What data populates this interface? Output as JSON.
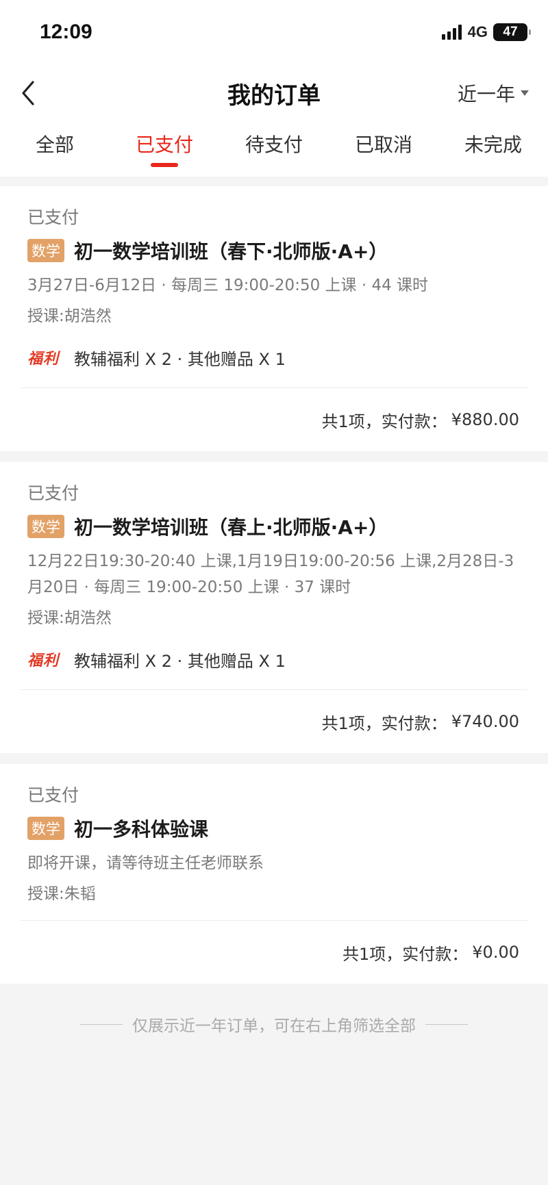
{
  "status_bar": {
    "time": "12:09",
    "network": "4G",
    "battery": "47"
  },
  "header": {
    "title": "我的订单",
    "range_filter": "近一年"
  },
  "tabs": [
    {
      "label": "全部",
      "active": false
    },
    {
      "label": "已支付",
      "active": true
    },
    {
      "label": "待支付",
      "active": false
    },
    {
      "label": "已取消",
      "active": false
    },
    {
      "label": "未完成",
      "active": false
    }
  ],
  "orders": [
    {
      "status": "已支付",
      "subject": "数学",
      "course": "初一数学培训班（春下·北师版·A+）",
      "schedule": "3月27日-6月12日 · 每周三 19:00-20:50 上课 · 44 课时",
      "teacher": "授课:胡浩然",
      "gift_logo": "福利",
      "gifts": "教辅福利 X 2 · 其他赠品 X 1",
      "summary_count": "共1项，实付款：",
      "amount": "¥880.00"
    },
    {
      "status": "已支付",
      "subject": "数学",
      "course": "初一数学培训班（春上·北师版·A+）",
      "schedule": "12月22日19:30-20:40 上课,1月19日19:00-20:56 上课,2月28日-3月20日 · 每周三 19:00-20:50 上课 · 37 课时",
      "teacher": "授课:胡浩然",
      "gift_logo": "福利",
      "gifts": "教辅福利 X 2 · 其他赠品 X 1",
      "summary_count": "共1项，实付款：",
      "amount": "¥740.00"
    },
    {
      "status": "已支付",
      "subject": "数学",
      "course": "初一多科体验课",
      "schedule": "即将开课，请等待班主任老师联系",
      "teacher": "授课:朱韬",
      "summary_count": "共1项，实付款：",
      "amount": "¥0.00"
    }
  ],
  "footer_note": "仅展示近一年订单，可在右上角筛选全部",
  "colors": {
    "accent": "#e8271c",
    "badge": "#e2a167",
    "background": "#f4f4f4"
  }
}
